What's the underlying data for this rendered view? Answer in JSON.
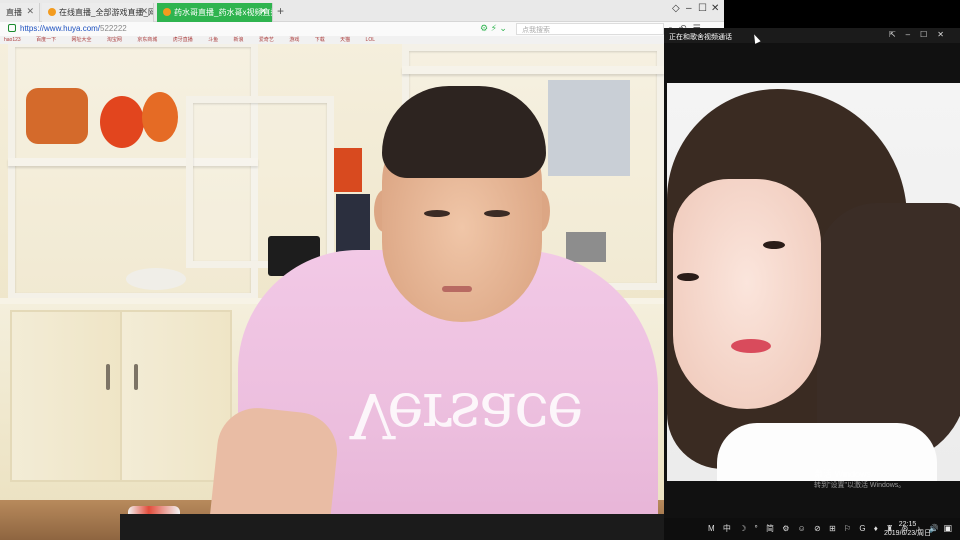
{
  "browser": {
    "tabs": [
      {
        "label": "直播",
        "active": false
      },
      {
        "label": "在线直播_全部游戏直播_网络游",
        "active": false
      },
      {
        "label": "药水哥直播_药水哥x视频直播间",
        "active": true
      }
    ],
    "new_tab_label": "+",
    "address": {
      "host": "https://www.huya.com/",
      "path": "522222"
    },
    "search_placeholder": "点我搜索",
    "window_controls": {
      "minimize": "–",
      "maximize": "☐",
      "close": "✕"
    },
    "bookmarks": [
      "hao123",
      "百度一下",
      "网址大全",
      "淘宝网",
      "京东商城",
      "虎牙直播",
      "斗鱼",
      "新浪",
      "爱奇艺",
      "游戏",
      "下载",
      "天猫",
      "LOL"
    ]
  },
  "stream": {
    "shirt_text": "Versace"
  },
  "call_window": {
    "title": "正在和歌舍视频通话",
    "controls": [
      "⇱",
      "–",
      "☐",
      "✕"
    ],
    "watermark_line1": "激活 Windows",
    "watermark_line2": "转到\"设置\"以激活 Windows。"
  },
  "taskbar": {
    "tray_items": [
      "M",
      "中",
      "☽",
      "°",
      "简",
      "⚙",
      "☺",
      "⊘",
      "⊞",
      "⚐",
      "G",
      "♦",
      "♜",
      "⊛",
      "♪",
      "🔊"
    ],
    "time": "22:15",
    "date": "2019/6/23/周日",
    "notifications_icon": "▣"
  },
  "colors": {
    "active_tab": "#2fb44f",
    "url": "#1b4fbf",
    "taskbar": "#0e0e0e",
    "shirt": "#f2c9e6"
  }
}
